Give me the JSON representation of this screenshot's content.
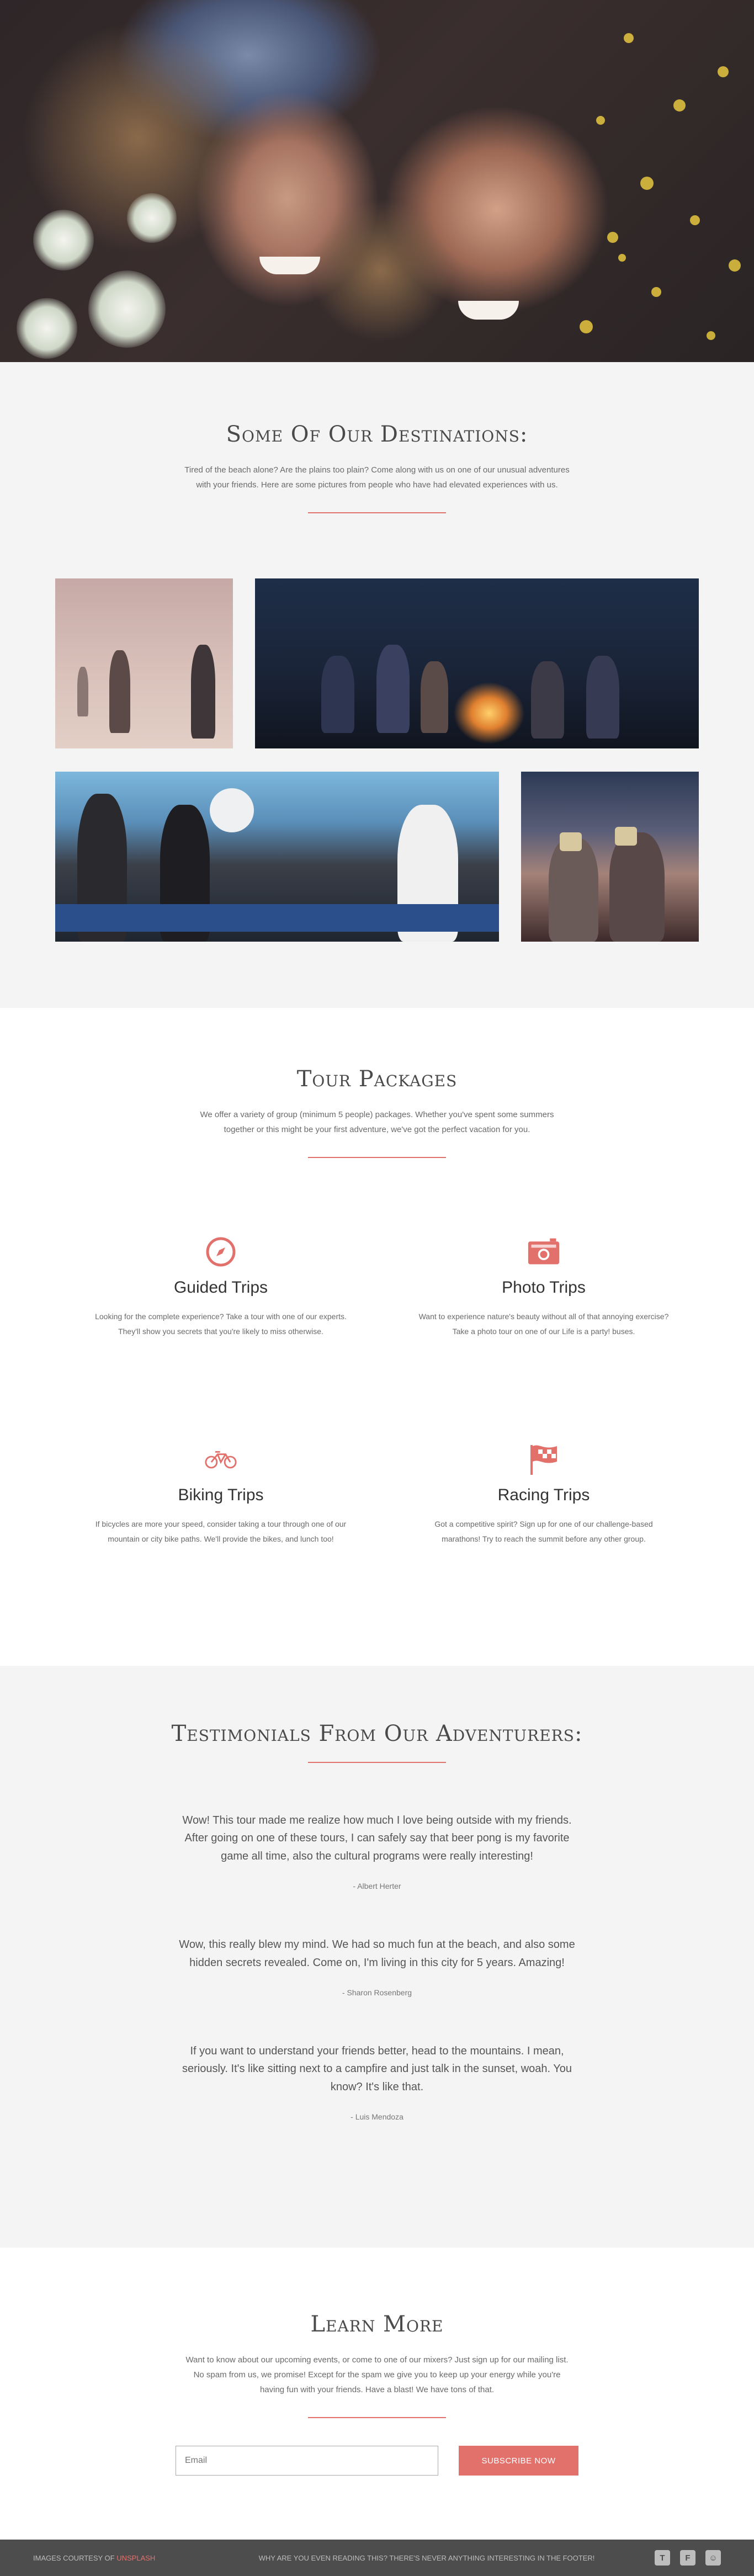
{
  "hero": {
    "image": "two-smiling-women-lying-on-grass"
  },
  "destinations": {
    "title": "Some Of Our Destinations:",
    "intro": "Tired of the beach alone? Are the plains too plain? Come along with us on one of our unusual adventures with your friends. Here are some pictures from people who have had elevated experiences with us.",
    "photos": [
      "desert-walkers",
      "campfire-night",
      "ping-pong-party",
      "friends-with-cameras"
    ]
  },
  "tours": {
    "title": "Tour Packages",
    "intro": "We offer a variety of group (minimum 5 people) packages. Whether you've spent some summers together or this might be your first adventure, we've got the perfect vacation for you.",
    "items": [
      {
        "title": "Guided Trips",
        "icon": "compass-icon",
        "desc": "Looking for the complete experience? Take a tour with one of our experts. They'll show you secrets that you're likely to miss otherwise."
      },
      {
        "title": "Photo Trips",
        "icon": "camera-icon",
        "desc": "Want to experience nature's beauty without all of that annoying exercise? Take a photo tour on one of our Life is a party! buses."
      },
      {
        "title": "Biking Trips",
        "icon": "bicycle-icon",
        "desc": "If bicycles are more your speed, consider taking a tour through one of our mountain or city bike paths. We'll provide the bikes, and lunch too!"
      },
      {
        "title": "Racing Trips",
        "icon": "flag-icon",
        "desc": "Got a competitive spirit? Sign up for one of our challenge-based marathons! Try to reach the summit before any other group."
      }
    ],
    "accent": "#e2716c"
  },
  "testimonials": {
    "title": "Testimonials From Our Adventurers:",
    "items": [
      {
        "quote": "Wow! This tour made me realize how much I love being outside with my friends. After going on one of these tours, I can safely say that beer pong is my favorite game all time, also the cultural programs were really interesting!",
        "author": "- Albert Herter"
      },
      {
        "quote": "Wow, this really blew my mind. We had so much fun at the beach, and also some hidden secrets revealed. Come on, I'm living in this city for 5 years. Amazing!",
        "author": "- Sharon Rosenberg"
      },
      {
        "quote": "If you want to understand your friends better, head to the mountains. I mean, seriously. It's like sitting next to a campfire and just talk in the sunset, woah. You know? It's like that.",
        "author": "- Luis Mendoza"
      }
    ]
  },
  "learn_more": {
    "title": "Learn More",
    "intro": "Want to know about our upcoming events, or come to one of our mixers? Just sign up for our mailing list. No spam from us, we promise! Except for the spam we give you to keep up your energy while you're having fun with your friends. Have a blast! We have tons of that.",
    "email_placeholder": "Email",
    "subscribe_label": "Subscribe Now"
  },
  "footer": {
    "credit_prefix": "Images courtesy of ",
    "credit_link": "Unsplash",
    "tagline": "Why are you even reading this? There's never anything interesting in the footer!",
    "social": [
      {
        "icon": "twitter-icon",
        "glyph": "t"
      },
      {
        "icon": "facebook-icon",
        "glyph": "f"
      },
      {
        "icon": "snapchat-icon",
        "glyph": "☺"
      }
    ]
  }
}
